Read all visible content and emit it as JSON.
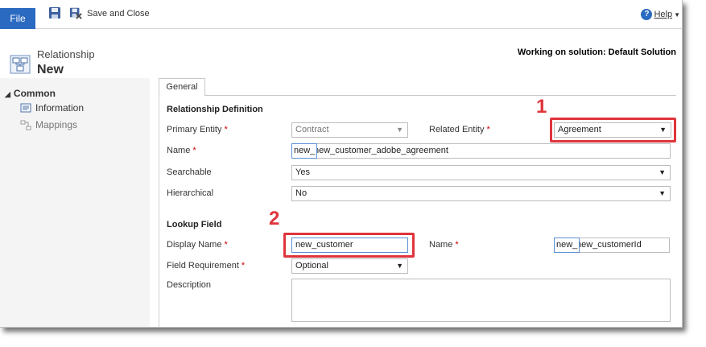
{
  "toolbar": {
    "file_label": "File",
    "save_and_close_label": "Save and Close",
    "help_label": "Help",
    "save_icon": "save-icon",
    "save_close_icon": "save-and-close-icon"
  },
  "header": {
    "entity_type": "Relationship",
    "record_title": "New",
    "solution_text": "Working on solution: Default Solution"
  },
  "nav": {
    "section": "Common",
    "items": [
      {
        "label": "Information"
      },
      {
        "label": "Mappings"
      }
    ]
  },
  "tabs": [
    {
      "label": "General"
    }
  ],
  "relationship_definition": {
    "title": "Relationship Definition",
    "primary_entity_label": "Primary Entity",
    "primary_entity_value": "Contract",
    "related_entity_label": "Related Entity",
    "related_entity_value": "Agreement",
    "name_label": "Name",
    "name_prefix": "new_",
    "name_value": "new_customer_adobe_agreement",
    "searchable_label": "Searchable",
    "searchable_value": "Yes",
    "hierarchical_label": "Hierarchical",
    "hierarchical_value": "No"
  },
  "lookup_field": {
    "title": "Lookup Field",
    "display_name_label": "Display Name",
    "display_name_value": "new_customer",
    "name_label": "Name",
    "name_prefix": "new_",
    "name_value": "new_customerId",
    "field_requirement_label": "Field Requirement",
    "field_requirement_value": "Optional",
    "description_label": "Description",
    "description_value": ""
  },
  "annotations": {
    "callout_1": "1",
    "callout_2": "2",
    "highlight_color": "#e0343c"
  },
  "required_marker": "*",
  "colors": {
    "accent": "#2b6ac1",
    "required": "#cc0000"
  }
}
